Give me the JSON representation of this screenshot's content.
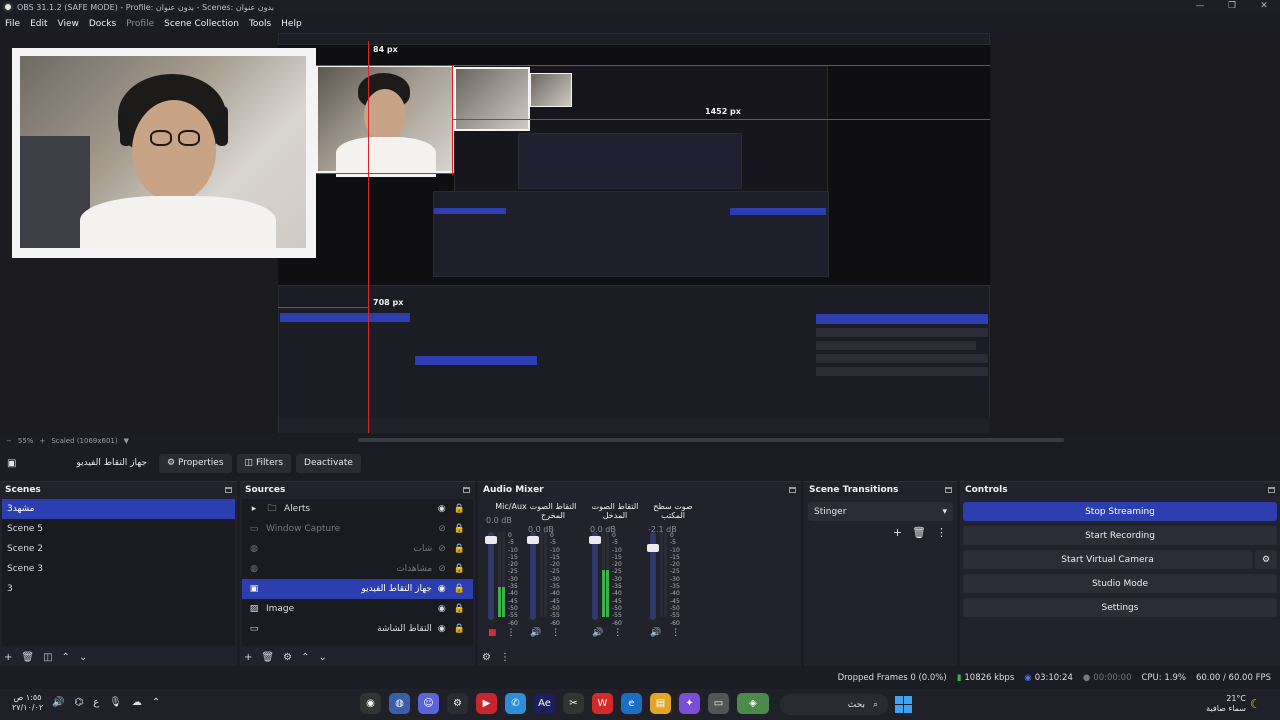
{
  "window": {
    "title": "OBS 31.1.2 (SAFE MODE) - Profile: بدون عنوان - Scenes: بدون عنوان",
    "controls": [
      "—",
      "❐",
      "✕"
    ]
  },
  "menu": [
    "File",
    "Edit",
    "View",
    "Docks",
    "Profile",
    "Scene Collection",
    "Tools",
    "Help"
  ],
  "preview": {
    "labels": [
      "84 px",
      "1452 px",
      "708 px"
    ],
    "zoom": {
      "minus": "−",
      "percent": "55%",
      "plus": "+",
      "mode": "Scaled (1069x601)"
    }
  },
  "context_bar": {
    "source_name": "جهاز التقاط الفيديو",
    "properties": "Properties",
    "filters": "Filters",
    "deactivate": "Deactivate"
  },
  "scenes": {
    "title": "Scenes",
    "items": [
      "مشهد3",
      "Scene 5",
      "Scene 2",
      "Scene 3",
      "3"
    ],
    "selected": 0
  },
  "sources": {
    "title": "Sources",
    "items": [
      {
        "name": "Alerts",
        "icon": "folder-icon",
        "rtl": false
      },
      {
        "name": "Window Capture",
        "icon": "window-icon",
        "rtl": false
      },
      {
        "name": "شات",
        "icon": "globe-icon",
        "rtl": true
      },
      {
        "name": "مشاهدات",
        "icon": "globe-icon",
        "rtl": true
      },
      {
        "name": "جهاز التقاط الفيديو",
        "icon": "camera-icon",
        "rtl": true
      },
      {
        "name": "Image",
        "icon": "image-icon",
        "rtl": false
      },
      {
        "name": "التقاط الشاشة",
        "icon": "monitor-icon",
        "rtl": true
      }
    ],
    "selected": 4
  },
  "mixer": {
    "title": "Audio Mixer",
    "channels": [
      {
        "name": "Mic/Aux",
        "db": "0.0 dB",
        "level": 0.35,
        "fader": 0.95
      },
      {
        "name": "التقاط الصوت المخرج",
        "db": "0.0 dB",
        "level": 0.0,
        "fader": 0.95
      },
      {
        "name": "التقاط الصوت المدخل",
        "db": "0.0 dB",
        "level": 0.55,
        "fader": 0.95
      },
      {
        "name": "صوت سطح المكتب",
        "db": "-2.1 dB",
        "level": 0.0,
        "fader": 0.85
      }
    ],
    "scale": [
      "0",
      "-5",
      "-10",
      "-15",
      "-20",
      "-25",
      "-30",
      "-35",
      "-40",
      "-45",
      "-50",
      "-55",
      "-60"
    ]
  },
  "transitions": {
    "title": "Scene Transitions",
    "selected": "Stinger"
  },
  "controls": {
    "title": "Controls",
    "buttons": [
      "Stop Streaming",
      "Start Recording",
      "Start Virtual Camera",
      "Studio Mode",
      "Settings"
    ]
  },
  "status": {
    "dropped": "Dropped Frames 0 (0.0%)",
    "bitrate": "10826 kbps",
    "stream_time": "03:10:24",
    "rec_time": "00:00:00",
    "cpu": "CPU: 1.9%",
    "fps": "60.00 / 60.00 FPS"
  },
  "taskbar": {
    "clock_time": "١:٥٥ ص",
    "clock_date": "٢٧/١٠/٠٢",
    "lang": "ع",
    "search_placeholder": "بحث",
    "weather_temp": "21°C",
    "weather_text": "سماء صافية"
  },
  "colors": {
    "accent": "#2d3eb0",
    "red_guides": "#d9242c",
    "meter_green": "#3bb34a"
  }
}
